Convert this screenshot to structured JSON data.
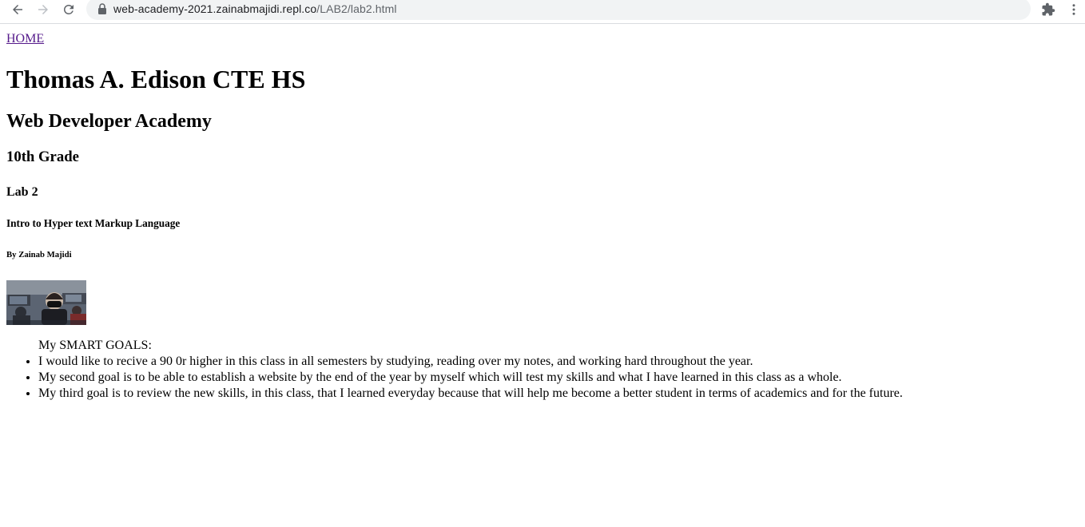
{
  "browser": {
    "url_host": "web-academy-2021.zainabmajidi.repl.co",
    "url_path": "/LAB2/lab2.html",
    "icons": {
      "back": "arrow-left-icon",
      "forward": "arrow-right-icon",
      "reload": "reload-icon",
      "secure": "lock-icon",
      "extensions": "puzzle-piece-icon",
      "menu": "kebab-menu-icon"
    }
  },
  "page": {
    "home_link": "HOME",
    "heading1": "Thomas A. Edison CTE HS",
    "heading2": "Web Developer Academy",
    "heading3": "10th Grade",
    "heading4": "Lab 2",
    "heading5": "Intro to Hyper text Markup Language",
    "heading6": "By Zainab Majidi",
    "goals_title": "My SMART GOALS:",
    "goals": [
      "I would like to recive a 90 0r higher in this class in all semesters by studying, reading over my notes, and working hard throughout the year.",
      "My second goal is to be able to establish a website by the end of the year by myself which will test my skills and what I have learned in this class as a whole.",
      "My third goal is to review the new skills, in this class, that I learned everyday because that will help me become a better student in terms of academics and for the future."
    ],
    "colors": {
      "visited_link": "#551a8b",
      "text": "#000000",
      "omnibox_bg": "#f1f3f4"
    }
  }
}
